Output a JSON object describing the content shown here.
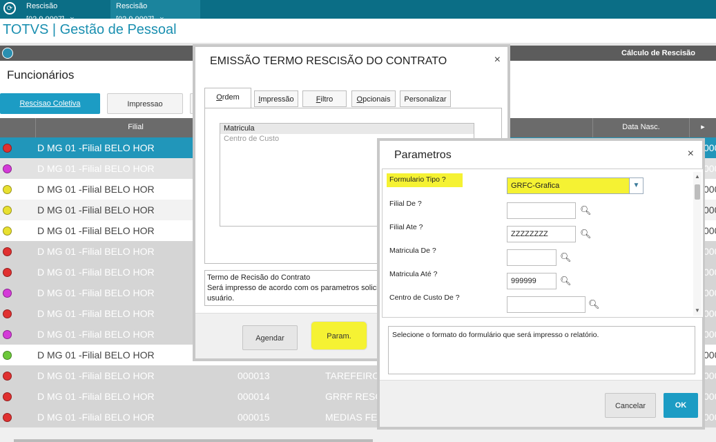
{
  "topbar": {
    "tabs": [
      {
        "label": "Rescisão [02.9.0007]",
        "close": "×"
      },
      {
        "label": "Rescisão [02.9.0007]",
        "close": "×"
      }
    ]
  },
  "app": {
    "title": "TOTVS | Gestão de Pessoal"
  },
  "main_bar": {
    "title": "Cálculo de Rescisão"
  },
  "section": {
    "title": "Funcionários"
  },
  "toolbar": {
    "rescisao_label": "Rescisao Coletiva",
    "impressao_label": "Impressao"
  },
  "grid": {
    "columns": {
      "filial": "Filial",
      "data_nasc": "Data Nasc.",
      "arrow": "▸"
    },
    "rows": [
      {
        "status_color": "#e03030",
        "filial": "D MG 01 -Filial BELO HOR",
        "matricula": "",
        "descricao": "",
        "right": "000"
      },
      {
        "status_color": "#d43ad8",
        "filial": "D MG 01 -Filial BELO HOR",
        "matricula": "",
        "descricao": "",
        "right": "000"
      },
      {
        "status_color": "#e8e030",
        "filial": "D MG 01 -Filial BELO HOR",
        "matricula": "",
        "descricao": "",
        "right": "000"
      },
      {
        "status_color": "#e8e030",
        "filial": "D MG 01 -Filial BELO HOR",
        "matricula": "",
        "descricao": "",
        "right": "000"
      },
      {
        "status_color": "#e8e030",
        "filial": "D MG 01 -Filial BELO HOR",
        "matricula": "",
        "descricao": "",
        "right": "000"
      },
      {
        "status_color": "#e03030",
        "filial": "D MG 01 -Filial BELO HOR",
        "matricula": "",
        "descricao": "",
        "right": "000"
      },
      {
        "status_color": "#e03030",
        "filial": "D MG 01 -Filial BELO HOR",
        "matricula": "",
        "descricao": "",
        "right": "000"
      },
      {
        "status_color": "#d43ad8",
        "filial": "D MG 01 -Filial BELO HOR",
        "matricula": "",
        "descricao": "",
        "right": "000"
      },
      {
        "status_color": "#e03030",
        "filial": "D MG 01 -Filial BELO HOR",
        "matricula": "",
        "descricao": "",
        "right": "000"
      },
      {
        "status_color": "#d43ad8",
        "filial": "D MG 01 -Filial BELO HOR",
        "matricula": "",
        "descricao": "",
        "right": "000"
      },
      {
        "status_color": "#6cc83a",
        "filial": "D MG 01 -Filial BELO HOR",
        "matricula": "",
        "descricao": "",
        "right": "000"
      },
      {
        "status_color": "#e03030",
        "filial": "D MG 01 -Filial BELO HOR",
        "matricula": "000013",
        "descricao": "TAREFEIRO",
        "right": "000"
      },
      {
        "status_color": "#e03030",
        "filial": "D MG 01 -Filial BELO HOR",
        "matricula": "000014",
        "descricao": "GRRF RESC",
        "right": "000"
      },
      {
        "status_color": "#e03030",
        "filial": "D MG 01 -Filial BELO HOR",
        "matricula": "000015",
        "descricao": "MEDIAS FE",
        "right": "000"
      }
    ]
  },
  "emissao": {
    "title": "EMISSÃO TERMO RESCISÃO DO CONTRATO",
    "close": "×",
    "tabs": {
      "ordem_u": "O",
      "ordem_rest": "rdem",
      "impressao_u": "I",
      "impressao_rest": "mpressão",
      "filtro_u": "F",
      "filtro_rest": "iltro",
      "opcionais_u": "O",
      "opcionais_rest": "pcionais",
      "personalizar": "Personalizar"
    },
    "order_items": [
      "Matricula",
      "Centro de Custo"
    ],
    "description": {
      "line1": "Termo de Recisão do Contrato",
      "line2": "Será impresso de acordo com os parametros solici",
      "line3": "usuário."
    },
    "agendar_label": "Agendar",
    "param_label": "Param."
  },
  "parametros": {
    "title": "Parametros",
    "close": "×",
    "fields": {
      "formulario_tipo": {
        "label": "Formulario Tipo ?",
        "value": "GRFC-Grafica",
        "arrow": "▼"
      },
      "filial_de": {
        "label": "Filial De ?",
        "value": ""
      },
      "filial_ate": {
        "label": "Filial Ate ?",
        "value": "ZZZZZZZZ"
      },
      "matricula_de": {
        "label": "Matricula De ?",
        "value": ""
      },
      "matricula_ate": {
        "label": "Matricula Até ?",
        "value": "999999"
      },
      "centro_custo_de": {
        "label": "Centro de Custo De ?",
        "value": ""
      }
    },
    "scroll_up": "▲",
    "scroll_down": "▼",
    "help_text": "Selecione o formato do formulário que será impresso o relatório.",
    "cancel_label": "Cancelar",
    "ok_label": "OK"
  }
}
